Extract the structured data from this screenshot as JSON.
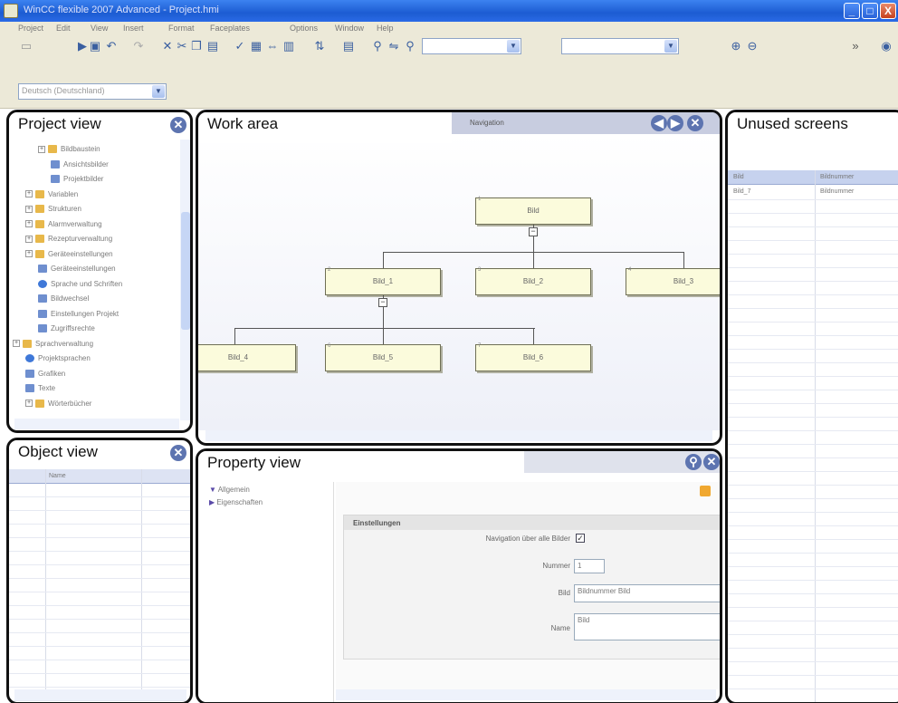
{
  "window": {
    "title": "WinCC flexible 2007 Advanced - Project.hmi",
    "buttons": [
      "_",
      "□",
      "X"
    ]
  },
  "menu": [
    "Project",
    "Edit",
    "View",
    "Insert",
    "Format",
    "Faceplates",
    "Options",
    "Window",
    "Help"
  ],
  "toolbar": {
    "font_combo": "",
    "zoom_combo": "",
    "language_combo": "Deutsch (Deutschland)"
  },
  "panels": {
    "project_view": {
      "label": "Project view"
    },
    "work_area": {
      "label": "Work area",
      "tab_label": "Navigation"
    },
    "unused_screens": {
      "label": "Unused screens"
    },
    "object_view": {
      "label": "Object view"
    },
    "property_view": {
      "label": "Property view"
    }
  },
  "project_tree": [
    {
      "label": "Bildbaustein",
      "level": 3,
      "icon": "folder"
    },
    {
      "label": "Ansichtsbilder",
      "level": 4,
      "icon": "doc"
    },
    {
      "label": "Projektbilder",
      "level": 4,
      "icon": "doc"
    },
    {
      "label": "Variablen",
      "level": 2,
      "icon": "folder"
    },
    {
      "label": "Strukturen",
      "level": 2,
      "icon": "folder"
    },
    {
      "label": "Alarmverwaltung",
      "level": 2,
      "icon": "folder"
    },
    {
      "label": "Rezepturverwaltung",
      "level": 2,
      "icon": "folder"
    },
    {
      "label": "Geräteeinstellungen",
      "level": 2,
      "icon": "folder"
    },
    {
      "label": "Geräteeinstellungen",
      "level": 3,
      "icon": "doc"
    },
    {
      "label": "Sprache und Schriften",
      "level": 3,
      "icon": "globe"
    },
    {
      "label": "Bildwechsel",
      "level": 3,
      "icon": "doc"
    },
    {
      "label": "Einstellungen Projekt",
      "level": 3,
      "icon": "doc"
    },
    {
      "label": "Zugriffsrechte",
      "level": 3,
      "icon": "doc"
    },
    {
      "label": "Sprachverwaltung",
      "level": 1,
      "icon": "folder"
    },
    {
      "label": "Projektsprachen",
      "level": 2,
      "icon": "globe"
    },
    {
      "label": "Grafiken",
      "level": 2,
      "icon": "doc"
    },
    {
      "label": "Texte",
      "level": 2,
      "icon": "doc"
    },
    {
      "label": "Wörterbücher",
      "level": 2,
      "icon": "folder"
    }
  ],
  "navigation_tree": {
    "root": {
      "num": "1",
      "label": "Bild"
    },
    "level2": [
      {
        "num": "2",
        "label": "Bild_1"
      },
      {
        "num": "3",
        "label": "Bild_2"
      },
      {
        "num": "4",
        "label": "Bild_3"
      }
    ],
    "level3": [
      {
        "num": "5",
        "label": "Bild_4"
      },
      {
        "num": "6",
        "label": "Bild_5"
      },
      {
        "num": "7",
        "label": "Bild_6"
      }
    ]
  },
  "unused_screens_table": {
    "headers": [
      "Bild",
      "Bildnummer"
    ],
    "rows": [
      [
        "Bild_7",
        "Bildnummer"
      ]
    ]
  },
  "object_view_table": {
    "headers": [
      "",
      "Name",
      ""
    ]
  },
  "property_view": {
    "categories": [
      "Allgemein",
      "Eigenschaften"
    ],
    "section_title": "Einstellungen",
    "fields": {
      "checkbox_label": "Navigation über alle Bilder",
      "checkbox_checked": "✓",
      "number_label": "Nummer",
      "number_value": "1",
      "bild_label": "Bild",
      "bild_value": "Bildnummer   Bild",
      "name_label": "Name",
      "name_value": "Bild"
    }
  }
}
